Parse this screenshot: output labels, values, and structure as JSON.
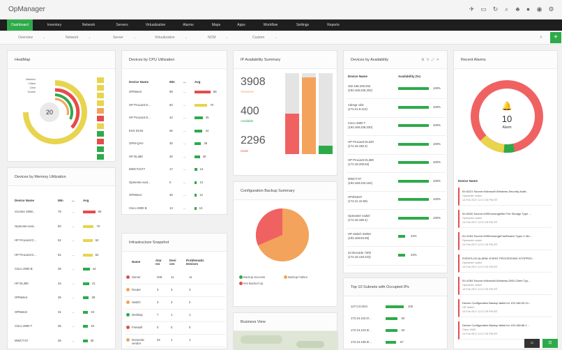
{
  "app": {
    "title": "OpManager"
  },
  "menu": [
    "Dashboard",
    "Inventory",
    "Network",
    "Servers",
    "Virtualization",
    "Alarms",
    "Maps",
    "Apps",
    "Workflow",
    "Settings",
    "Reports"
  ],
  "submenu": [
    "Overview",
    "Network",
    "Server",
    "Virtualization",
    "NCM",
    "Custom"
  ],
  "heatmap": {
    "title": "HeatMap",
    "center": "20",
    "legend": [
      "Attention",
      "Critical",
      "Clear",
      "Trouble"
    ]
  },
  "cpu": {
    "title": "Devices by CPU Utilization",
    "headers": [
      "Device Name",
      "Min",
      "...",
      "Avg"
    ],
    "rows": [
      {
        "name": "OPMete2",
        "min": "99",
        "dots": "...",
        "avg": "88"
      },
      {
        "name": "HP ProLiant D...",
        "min": "60",
        "dots": "...",
        "avg": "70"
      },
      {
        "name": "HP ProLiant D...",
        "min": "42",
        "dots": "...",
        "avg": "45"
      },
      {
        "name": "ESX DCNI",
        "min": "65",
        "dots": "...",
        "avg": "44"
      },
      {
        "name": "OPM-QAH",
        "min": "30",
        "dots": "...",
        "avg": "36"
      },
      {
        "name": "HP DL380",
        "min": "30",
        "dots": "...",
        "avg": "30"
      },
      {
        "name": "MWCT21T7",
        "min": "17",
        "dots": "...",
        "avg": "14"
      },
      {
        "name": "Opmente-vval...",
        "min": "0",
        "dots": "...",
        "avg": "13"
      },
      {
        "name": "OPMete4",
        "min": "35",
        "dots": "...",
        "avg": "12"
      },
      {
        "name": "Cisco 2900 B",
        "min": "13",
        "dots": "...",
        "avg": "10"
      }
    ]
  },
  "ip": {
    "title": "IP Availability Summary",
    "total": "3908",
    "total_label": "Transient",
    "available": "400",
    "available_label": "Available",
    "used": "2296",
    "used_label": "Used"
  },
  "availability": {
    "title": "Devices by Availability",
    "headers": [
      "Device Name",
      "Availability (%)"
    ],
    "rows": [
      {
        "name": "192.168.228.202 (192.168.228.202)",
        "val": "100%"
      },
      {
        "name": "Adesgr vdsr (172.21.9.212)",
        "val": "100%"
      },
      {
        "name": "Cisco 2800 T (192.168.228.230)",
        "val": "100%"
      },
      {
        "name": "HP ProLiant DL320 (172.18.190.4)",
        "val": "100%"
      },
      {
        "name": "HP ProLiant DL380 (172.18.208.63)",
        "val": "100%"
      },
      {
        "name": "MWCT-07 (192.168.234.164)",
        "val": "100%"
      },
      {
        "name": "HP301847 (172.21.10.69)",
        "val": "100%"
      },
      {
        "name": "Opmanter vsdsrl (172.18.189.4)",
        "val": "100%"
      },
      {
        "name": "HP Switch 2609A (192.168.83.69)",
        "val": "23%"
      },
      {
        "name": "Z4 Brocade 7400 (172.18.148.223)",
        "val": "23%"
      }
    ]
  },
  "alarms": {
    "title": "Recent Alarms",
    "count": "10",
    "count_label": "Alarm",
    "list_header": "Device Name",
    "items": [
      {
        "t": "ID=6221 Source=Microsoft-Windows-Security-Audit...",
        "d": "Opmanter vsdsrl",
        "ts": "14 Feb 2017 12:17:25 PM IST"
      },
      {
        "t": "ID=6032 Source=MSExchangeMid Tier Storage Type ...",
        "d": "Opmanter vsdsrl",
        "ts": "14 Feb 2017 12:17:25 PM IST"
      },
      {
        "t": "ID=1054 Source=MSExchangeFastSearch Type=1 Me...",
        "d": "Opmanter vsdsrl",
        "ts": "14 Feb 2017 12:17:25 PM IST"
      },
      {
        "t": "EVENTLOG ALARM: EVENT PROCESSING STOPPED...",
        "d": "Opmanter vsdsrl",
        "ts": "14 Feb 2017 12:17:25 PM IST"
      },
      {
        "t": "ID=1054 Source=Microsoft-Windows-DNS-Client Typ...",
        "d": "Opmanter vsdsrl",
        "ts": "14 Feb 2017 12:17:25 PM IST"
      },
      {
        "t": "Device Configuration Backup failed for 192.168.93.14...",
        "d": "HP Switch",
        "ts": "14 Feb 2017 12:17:25 PM IST"
      },
      {
        "t": "Device Configuration Backup failed for 192.168.86.1...",
        "d": "Cisco 2900",
        "ts": "14 Feb 2017 12:17:25 PM IST"
      }
    ]
  },
  "memory": {
    "title": "Devices by Memory Utilization",
    "headers": [
      "Device Name",
      "Min",
      "...",
      "Avg"
    ],
    "rows": [
      {
        "name": "vCenter 2008...",
        "min": "76",
        "dots": "...",
        "avg": "80"
      },
      {
        "name": "Opmente-vval...",
        "min": "60",
        "dots": "...",
        "avg": "70"
      },
      {
        "name": "HP ProLiant D...",
        "min": "52",
        "dots": "...",
        "avg": "62"
      },
      {
        "name": "HP ProLiant D...",
        "min": "51",
        "dots": "...",
        "avg": "62"
      },
      {
        "name": "Cisco 2900 B",
        "min": "36",
        "dots": "...",
        "avg": "44"
      },
      {
        "name": "HP DL380",
        "min": "34",
        "dots": "...",
        "avg": "41"
      },
      {
        "name": "OPMete4",
        "min": "36",
        "dots": "...",
        "avg": "38"
      },
      {
        "name": "OPMete2",
        "min": "31",
        "dots": "...",
        "avg": "33"
      },
      {
        "name": "Cisco 2800 T",
        "min": "36",
        "dots": "...",
        "avg": "33"
      },
      {
        "name": "MWCT-07",
        "min": "36",
        "dots": "...",
        "avg": "30"
      }
    ]
  },
  "backup": {
    "title": "Configuration Backup Summary",
    "legend": [
      "Backup Success",
      "Backup Failure",
      "Not Backed Up"
    ]
  },
  "infra": {
    "title": "Infrastructure Snapshot",
    "headers": [
      "",
      "Name",
      "Alar ms",
      "Devi ces",
      "Problematic Devices"
    ],
    "rows": [
      {
        "name": "Server",
        "a": "209",
        "d": "11",
        "p": "11"
      },
      {
        "name": "Router",
        "a": "3",
        "d": "3",
        "p": "3"
      },
      {
        "name": "Switch",
        "a": "3",
        "d": "2",
        "p": "2"
      },
      {
        "name": "Desktop",
        "a": "7",
        "d": "1",
        "p": "1"
      },
      {
        "name": "Firewall",
        "a": "0",
        "d": "0",
        "p": "0"
      },
      {
        "name": "Domestic vendor",
        "a": "32",
        "d": "1",
        "p": "1"
      }
    ]
  },
  "business": {
    "title": "Business View"
  },
  "subnets": {
    "title": "Top 10 Subnets with Occupied IPs",
    "rows": [
      {
        "name": "127.0.0.0/24",
        "val": "100"
      },
      {
        "name": "172.24.110.0/...",
        "val": "64"
      },
      {
        "name": "172.24.123.0/...",
        "val": "64"
      },
      {
        "name": "172.24.109.0/...",
        "val": "57"
      }
    ]
  },
  "colors": {
    "green": "#2eaa4a",
    "red": "#e64b4b",
    "yellow": "#e8d44d",
    "orange": "#f3a35b"
  }
}
